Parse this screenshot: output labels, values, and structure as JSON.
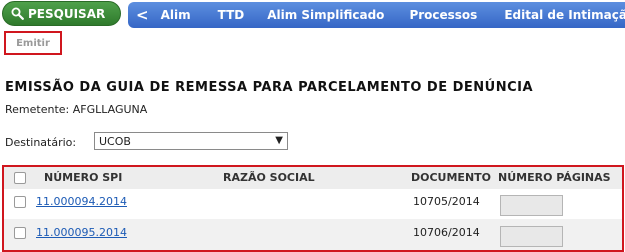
{
  "toolbar": {
    "search_label": "PESQUISAR",
    "search_icon": "magnifier-icon",
    "back_label": "<",
    "nav_items": [
      "Alim",
      "TTD",
      "Alim Simplificado",
      "Processos",
      "Edital de Intimação"
    ]
  },
  "actions": {
    "emitir_label": "Emitir"
  },
  "page": {
    "title": "EMISSÃO DA GUIA DE REMESSA PARA PARCELAMENTO DE DENÚNCIA",
    "remetente": "Remetente: AFGLLAGUNA",
    "destinatario_label": "Destinatário:",
    "destinatario_value": "UCOB"
  },
  "table": {
    "headers": [
      "NÚMERO SPI",
      "RAZÃO SOCIAL",
      "DOCUMENTO",
      "NÚMERO PÁGINAS"
    ],
    "rows": [
      {
        "numero_spi": "11.000094.2014",
        "razao_social": "",
        "documento": "10705/2014",
        "paginas": ""
      },
      {
        "numero_spi": "11.000095.2014",
        "razao_social": "",
        "documento": "10706/2014",
        "paginas": ""
      }
    ]
  },
  "colors": {
    "highlight_border": "#d0161e",
    "nav_blue": "#3f73d1",
    "search_green": "#3d8c39",
    "link": "#1d5bb5"
  }
}
